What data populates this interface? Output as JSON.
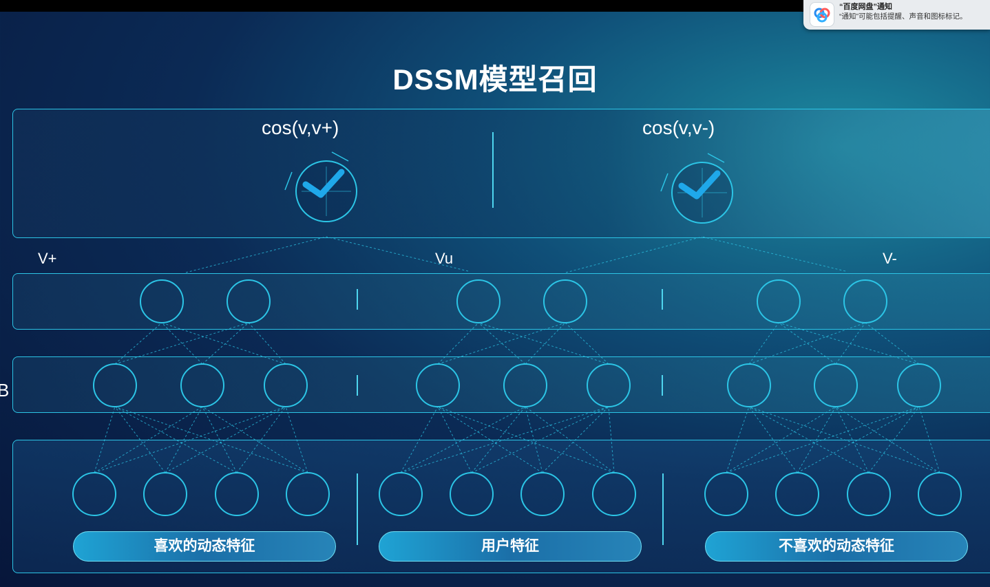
{
  "notification": {
    "title": "“百度网盘”通知",
    "body": "“通知”可能包括提醒、声音和图标标记。",
    "icon": "baidu-netdisk-icon"
  },
  "title": "DSSM模型召回",
  "top": {
    "left_formula": "cos(v,v+)",
    "right_formula": "cos(v,v-)",
    "icon": "checkmark-dial-icon"
  },
  "vectors": {
    "left": "V+",
    "middle": "Vu",
    "right": "V-"
  },
  "side_label": "B",
  "inputs": {
    "left": "喜欢的动态特征",
    "middle": "用户特征",
    "right": "不喜欢的动态特征"
  },
  "colors": {
    "accent": "#2cc5e6",
    "check": "#1fa8ea",
    "title": "#ffffff"
  }
}
